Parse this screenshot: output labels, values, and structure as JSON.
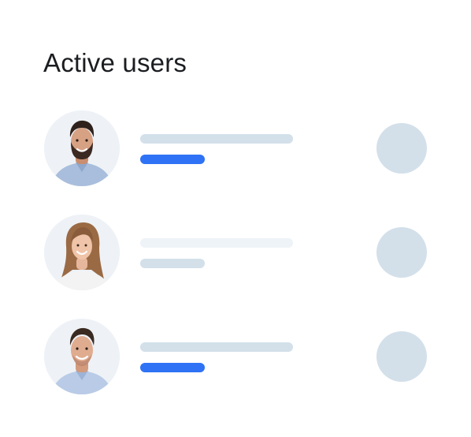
{
  "card": {
    "title": "Active users"
  },
  "colors": {
    "bar_primary": "#d3e0ea",
    "bar_faint": "#eef3f7",
    "bar_accent": "#2f72f5",
    "action_circle": "#d3e0ea",
    "avatar_background": "#eef2f6"
  },
  "users": [
    {
      "avatar_icon": "avatar-bearded-man-icon",
      "name_bar_color": "#d3e0ea",
      "status_bar_color": "#2f72f5"
    },
    {
      "avatar_icon": "avatar-woman-icon",
      "name_bar_color": "#eef3f7",
      "status_bar_color": "#d3e0ea"
    },
    {
      "avatar_icon": "avatar-man-icon",
      "name_bar_color": "#d3e0ea",
      "status_bar_color": "#2f72f5"
    }
  ]
}
